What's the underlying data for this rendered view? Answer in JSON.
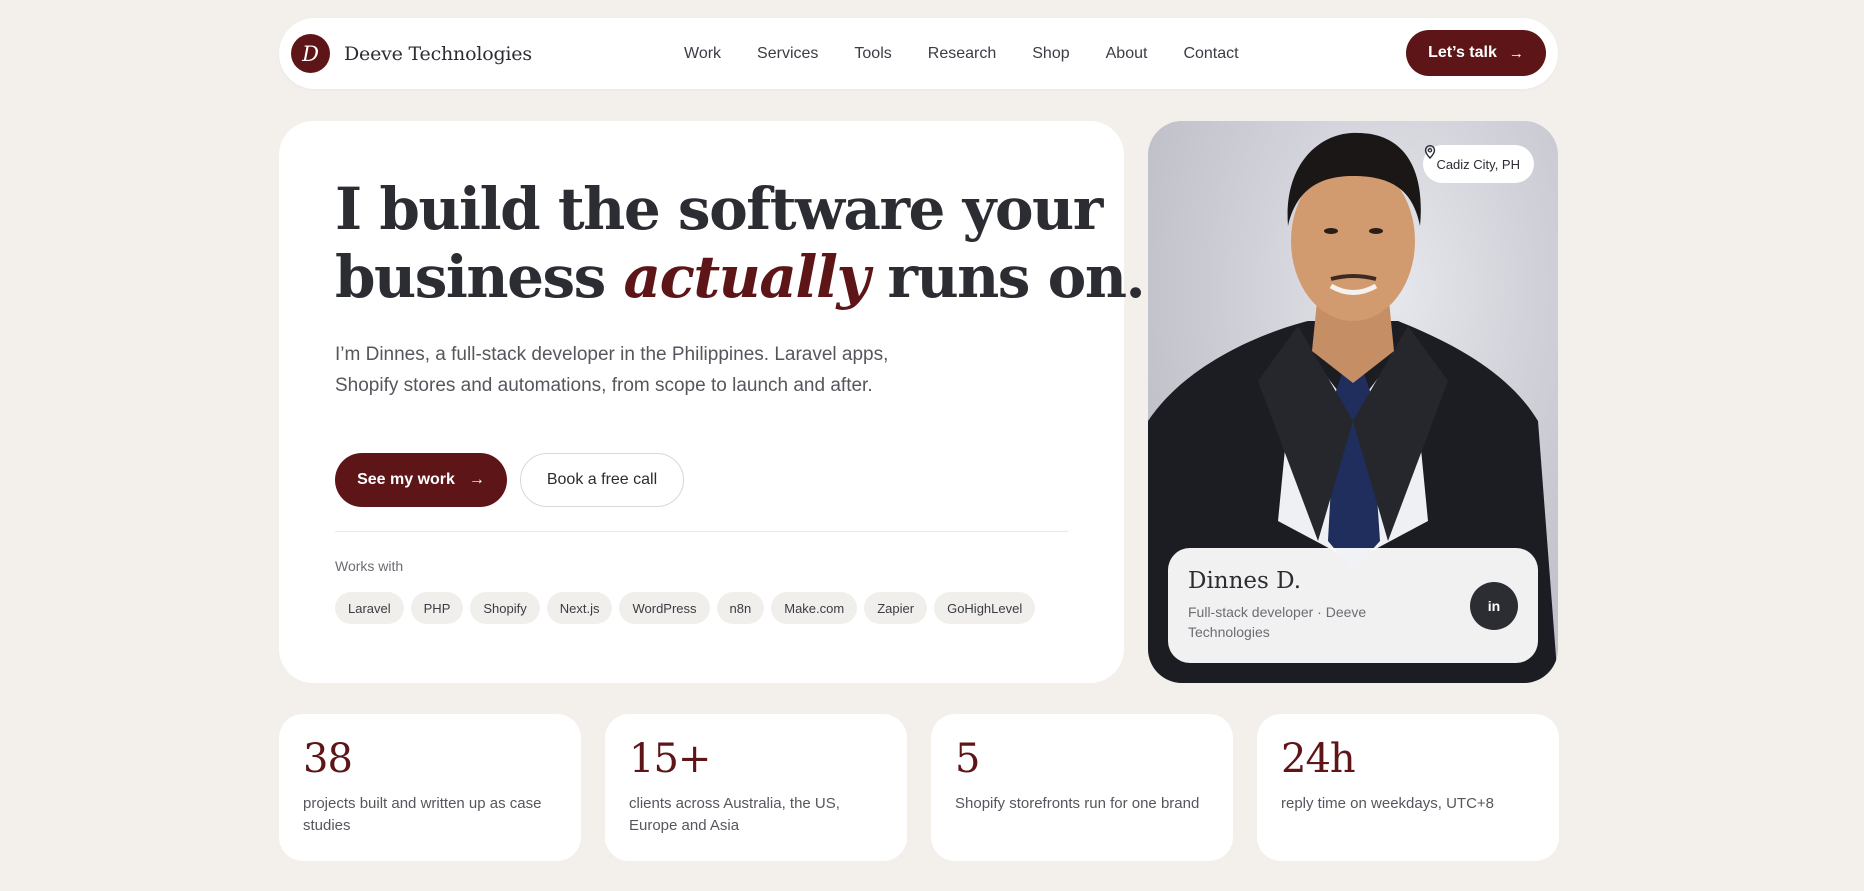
{
  "brand": {
    "mark": "D",
    "name": "Deeve Technologies"
  },
  "nav": {
    "links": [
      "Work",
      "Services",
      "Tools",
      "Research",
      "Shop",
      "About",
      "Contact"
    ],
    "cta_label": "Let’s talk",
    "cta_icon": "arrow-right-icon"
  },
  "hero": {
    "headline_line1": "I build the software your",
    "headline_pre": "business ",
    "headline_em": "actually",
    "headline_post": " runs on.",
    "lede": "I’m Dinnes, a full-stack developer in the Philippines. Laravel apps, Shopify stores and automations, from scope to launch and after.",
    "primary_button": "See my work",
    "secondary_button": "Book a free call",
    "works_with_label": "Works with",
    "tools": [
      "Laravel",
      "PHP",
      "Shopify",
      "Next.js",
      "WordPress",
      "n8n",
      "Make.com",
      "Zapier",
      "GoHighLevel"
    ]
  },
  "profile": {
    "location": "Cadiz City, PH",
    "location_icon": "map-pin-icon",
    "name": "Dinnes D.",
    "role": "Full-stack developer · Deeve Technologies",
    "linkedin_label": "in"
  },
  "stats": [
    {
      "value": "38",
      "label": "projects built and written up as case studies"
    },
    {
      "value": "15+",
      "label": "clients across Australia, the US, Europe and Asia"
    },
    {
      "value": "5",
      "label": "Shopify storefronts run for one brand"
    },
    {
      "value": "24h",
      "label": "reply time on weekdays, UTC+8"
    }
  ],
  "colors": {
    "accent": "#5e1518",
    "background": "#f3f0ec",
    "ink": "#2b2d33"
  }
}
